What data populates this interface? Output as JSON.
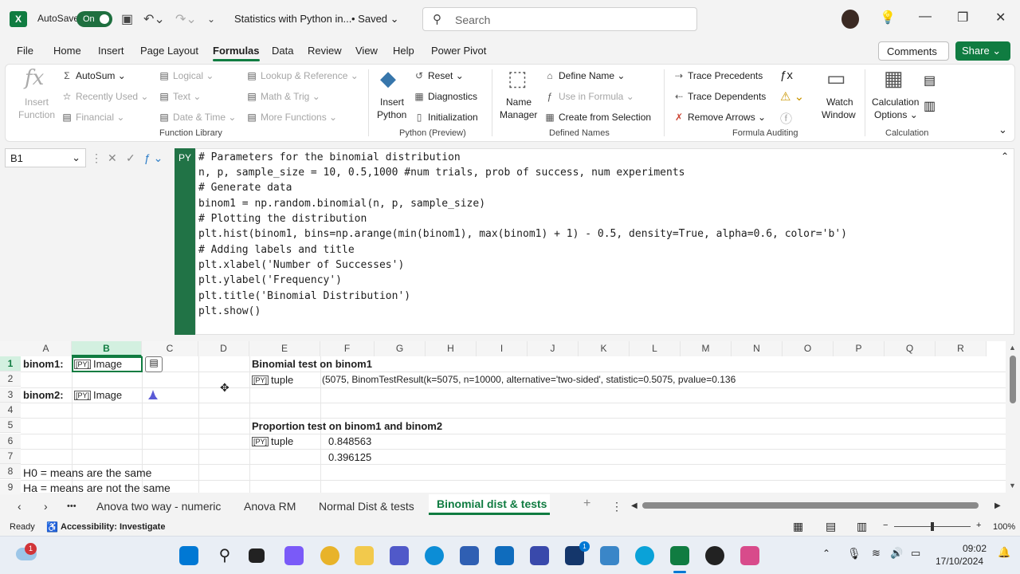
{
  "titlebar": {
    "autosave_label": "AutoSave",
    "toggle_label": "On",
    "doc_title": "Statistics with Python in...",
    "saved_label": "• Saved ⌄",
    "search_placeholder": "Search"
  },
  "menu": {
    "items": [
      "File",
      "Home",
      "Insert",
      "Page Layout",
      "Formulas",
      "Data",
      "Review",
      "View",
      "Help",
      "Power Pivot"
    ],
    "active": "Formulas",
    "comments_label": "Comments",
    "share_label": "Share ⌄"
  },
  "ribbon": {
    "insert_function": [
      "Insert",
      "Function"
    ],
    "autosum": "AutoSum",
    "recently_used": "Recently Used",
    "financial": "Financial",
    "logical": "Logical",
    "text": "Text",
    "date_time": "Date & Time",
    "lookup_reference": "Lookup & Reference",
    "math_trig": "Math & Trig",
    "more_functions": "More Functions",
    "function_library_label": "Function Library",
    "insert_python": [
      "Insert",
      "Python"
    ],
    "reset": "Reset",
    "diagnostics": "Diagnostics",
    "initialization": "Initialization",
    "python_preview_label": "Python (Preview)",
    "name_manager": [
      "Name",
      "Manager"
    ],
    "define_name": "Define Name",
    "use_in_formula": "Use in Formula",
    "create_from_selection": "Create from Selection",
    "defined_names_label": "Defined Names",
    "trace_precedents": "Trace Precedents",
    "trace_dependents": "Trace Dependents",
    "remove_arrows": "Remove Arrows",
    "watch_window": [
      "Watch",
      "Window"
    ],
    "formula_auditing_label": "Formula Auditing",
    "calculation_options": [
      "Calculation",
      "Options ⌄"
    ],
    "calculation_label": "Calculation"
  },
  "formula_bar": {
    "name_box": "B1",
    "py_badge": "PY",
    "code_lines": [
      "# Parameters for the binomial distribution",
      "n, p, sample_size = 10, 0.5,1000 #num trials, prob of success, num experiments",
      "# Generate data",
      "binom1 = np.random.binomial(n, p, sample_size)",
      "# Plotting the distribution",
      "plt.hist(binom1, bins=np.arange(min(binom1), max(binom1) + 1) - 0.5, density=True, alpha=0.6, color='b')",
      "# Adding labels and title",
      "plt.xlabel('Number of Successes')",
      "plt.ylabel('Frequency')",
      "plt.title('Binomial Distribution')",
      "plt.show()"
    ]
  },
  "grid": {
    "columns": [
      "A",
      "B",
      "C",
      "D",
      "E",
      "F",
      "G",
      "H",
      "I",
      "J",
      "K",
      "L",
      "M",
      "N",
      "O",
      "P",
      "Q",
      "R"
    ],
    "rows": [
      "1",
      "2",
      "3",
      "4",
      "5",
      "6",
      "7",
      "8",
      "9"
    ],
    "cells": {
      "A1": "binom1:",
      "B1": "Image",
      "A3": "binom2:",
      "B3": "Image",
      "E1": "Binomial test on binom1",
      "E2": "tuple",
      "F2": "(5075, BinomTestResult(k=5075, n=10000, alternative='two-sided', statistic=0.5075, pvalue=0.136",
      "E5": "Proportion test on binom1 and binom2",
      "E6": "tuple",
      "F6": "0.848563",
      "F7": "0.396125",
      "A8": "H0 = means are the same",
      "A9": "Ha = means are not the same"
    },
    "py_badge_small": "[PY]"
  },
  "sheet_tabs": {
    "items": [
      "Anova two way - numeric",
      "Anova RM",
      "Normal Dist & tests",
      "Binomial dist & tests"
    ],
    "active": "Binomial dist & tests",
    "more": "•••",
    "add": "+",
    "options": "⋮"
  },
  "status": {
    "ready": "Ready",
    "accessibility": "Accessibility: Investigate",
    "zoom": "100%"
  },
  "taskbar": {
    "time": "09:02",
    "date": "17/10/2024",
    "weather_badge": "1",
    "teams_badge": "1"
  },
  "colors": {
    "excel_green": "#107c41",
    "py_green": "#217346"
  }
}
